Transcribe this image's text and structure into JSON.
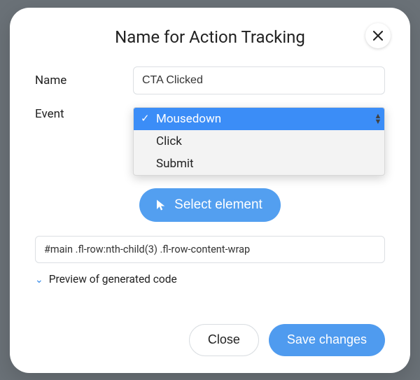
{
  "dialog": {
    "title": "Name for Action Tracking"
  },
  "form": {
    "name_label": "Name",
    "name_value": "CTA Clicked",
    "event_label": "Event",
    "event_options": {
      "0": "Mousedown",
      "1": "Click",
      "2": "Submit"
    },
    "event_selected_index": 0,
    "select_element_label": "Select element",
    "selector_value": "#main .fl-row:nth-child(3) .fl-row-content-wrap",
    "preview_label": "Preview of generated code"
  },
  "buttons": {
    "close": "Close",
    "save": "Save changes"
  },
  "colors": {
    "accent": "#4f9bef",
    "dropdown_highlight": "#3b8df7"
  }
}
